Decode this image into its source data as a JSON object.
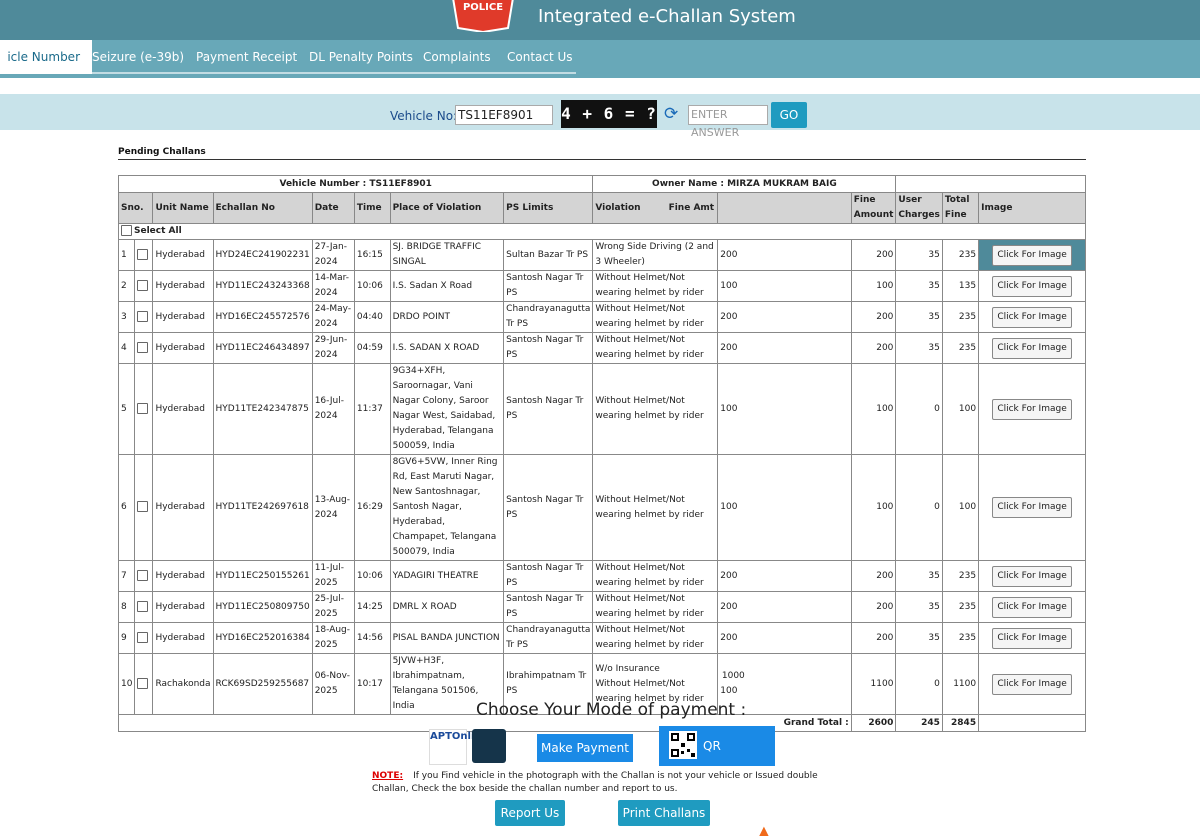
{
  "header": {
    "title": "Integrated e-Challan System",
    "logo_text": "POLICE"
  },
  "nav": {
    "items": [
      {
        "label": "icle Number"
      },
      {
        "label": "Seizure (e-39b)"
      },
      {
        "label": "Payment Receipt"
      },
      {
        "label": "DL Penalty Points"
      },
      {
        "label": "Complaints"
      },
      {
        "label": "Contact Us"
      }
    ]
  },
  "search": {
    "vehicle_label": "Vehicle No:",
    "vehicle_value": "TS11EF8901",
    "captcha_text": "4 + 6 = ?",
    "answer_placeholder": "ENTER ANSWER",
    "go_label": "GO"
  },
  "pending": {
    "title": "Pending Challans",
    "vehicle_number_label": "Vehicle Number :",
    "vehicle_number_value": "TS11EF8901",
    "owner_label": "Owner Name :",
    "owner_value": "MIRZA MUKRAM BAIG",
    "select_all_label": "Select All",
    "button_label": "Click For Image",
    "columns": [
      "Sno.",
      "Unit Name",
      "Echallan No",
      "Date",
      "Time",
      "Place of Violation",
      "PS Limits",
      "Violation",
      "Fine Amt",
      "Fine Amount",
      "User Charges",
      "Total Fine",
      "Image"
    ],
    "rows": [
      {
        "sno": "1",
        "unit": "Hyderabad",
        "echallan": "HYD24EC241902231",
        "date": "27-Jan-2024",
        "time": "16:15",
        "place": "SJ. BRIDGE TRAFFIC SINGAL",
        "ps": "Sultan Bazar Tr PS",
        "violation": "Wrong Side Driving (2 and 3 Wheeler)",
        "fine_amt": "200",
        "fine_amount": "200",
        "user_charges": "35",
        "total": "235"
      },
      {
        "sno": "2",
        "unit": "Hyderabad",
        "echallan": "HYD11EC243243368",
        "date": "14-Mar-2024",
        "time": "10:06",
        "place": "I.S. Sadan X Road",
        "ps": "Santosh Nagar Tr PS",
        "violation": "Without Helmet/Not wearing helmet by rider",
        "fine_amt": "100",
        "fine_amount": "100",
        "user_charges": "35",
        "total": "135"
      },
      {
        "sno": "3",
        "unit": "Hyderabad",
        "echallan": "HYD16EC245572576",
        "date": "24-May-2024",
        "time": "04:40",
        "place": "DRDO POINT",
        "ps": "Chandrayanagutta Tr PS",
        "violation": "Without Helmet/Not wearing helmet by rider",
        "fine_amt": "200",
        "fine_amount": "200",
        "user_charges": "35",
        "total": "235"
      },
      {
        "sno": "4",
        "unit": "Hyderabad",
        "echallan": "HYD11EC246434897",
        "date": "29-Jun-2024",
        "time": "04:59",
        "place": "I.S. SADAN X ROAD",
        "ps": "Santosh Nagar Tr PS",
        "violation": "Without Helmet/Not wearing helmet by rider",
        "fine_amt": "200",
        "fine_amount": "200",
        "user_charges": "35",
        "total": "235"
      },
      {
        "sno": "5",
        "unit": "Hyderabad",
        "echallan": "HYD11TE242347875",
        "date": "16-Jul-2024",
        "time": "11:37",
        "place": "9G34+XFH, Saroornagar, Vani Nagar Colony, Saroor Nagar West, Saidabad, Hyderabad, Telangana 500059, India",
        "ps": "Santosh Nagar Tr PS",
        "violation": "Without Helmet/Not wearing helmet by rider",
        "fine_amt": "100",
        "fine_amount": "100",
        "user_charges": "0",
        "total": "100"
      },
      {
        "sno": "6",
        "unit": "Hyderabad",
        "echallan": "HYD11TE242697618",
        "date": "13-Aug-2024",
        "time": "16:29",
        "place": "8GV6+5VW, Inner Ring Rd, East Maruti Nagar, New Santoshnagar, Santosh Nagar, Hyderabad, Champapet, Telangana 500079, India",
        "ps": "Santosh Nagar Tr PS",
        "violation": "Without Helmet/Not wearing helmet by rider",
        "fine_amt": "100",
        "fine_amount": "100",
        "user_charges": "0",
        "total": "100"
      },
      {
        "sno": "7",
        "unit": "Hyderabad",
        "echallan": "HYD11EC250155261",
        "date": "11-Jul-2025",
        "time": "10:06",
        "place": "YADAGIRI THEATRE",
        "ps": "Santosh Nagar Tr PS",
        "violation": "Without Helmet/Not wearing helmet by rider",
        "fine_amt": "200",
        "fine_amount": "200",
        "user_charges": "35",
        "total": "235"
      },
      {
        "sno": "8",
        "unit": "Hyderabad",
        "echallan": "HYD11EC250809750",
        "date": "25-Jul-2025",
        "time": "14:25",
        "place": "DMRL X ROAD",
        "ps": "Santosh Nagar Tr PS",
        "violation": "Without Helmet/Not wearing helmet by rider",
        "fine_amt": "200",
        "fine_amount": "200",
        "user_charges": "35",
        "total": "235"
      },
      {
        "sno": "9",
        "unit": "Hyderabad",
        "echallan": "HYD16EC252016384",
        "date": "18-Aug-2025",
        "time": "14:56",
        "place": "PISAL BANDA JUNCTION",
        "ps": "Chandrayanagutta Tr PS",
        "violation": "Without Helmet/Not wearing helmet by rider",
        "fine_amt": "200",
        "fine_amount": "200",
        "user_charges": "35",
        "total": "235"
      },
      {
        "sno": "10",
        "unit": "Rachakonda",
        "echallan": "RCK69SD259255687",
        "date": "06-Nov-2025",
        "time": "10:17",
        "place": "5JVW+H3F, Ibrahimpatnam, Telangana 501506, India",
        "ps": "Ibrahimpatnam Tr PS",
        "violation": "W/o Insurance",
        "violation2": "Without Helmet/Not wearing helmet by rider",
        "fine_amt": "1000",
        "fine_amt2": "100",
        "fine_amount": "1100",
        "user_charges": "0",
        "total": "1100"
      }
    ],
    "grand_total_label": "Grand Total :",
    "grand_fine": "2600",
    "grand_user": "245",
    "grand_total": "2845"
  },
  "payment": {
    "title": "Choose Your Mode of payment :",
    "aptonline_label": "APTOnline",
    "make_payment_label": "Make Payment",
    "qr_payment_label": "QR Payment",
    "note_label": "NOTE:",
    "note_text": "If you Find vehicle in the photograph with the Challan is not your vehicle or Issued double Challan, Check the box beside the challan number and report to us.",
    "report_label": "Report Us",
    "print_label": "Print Challans"
  }
}
